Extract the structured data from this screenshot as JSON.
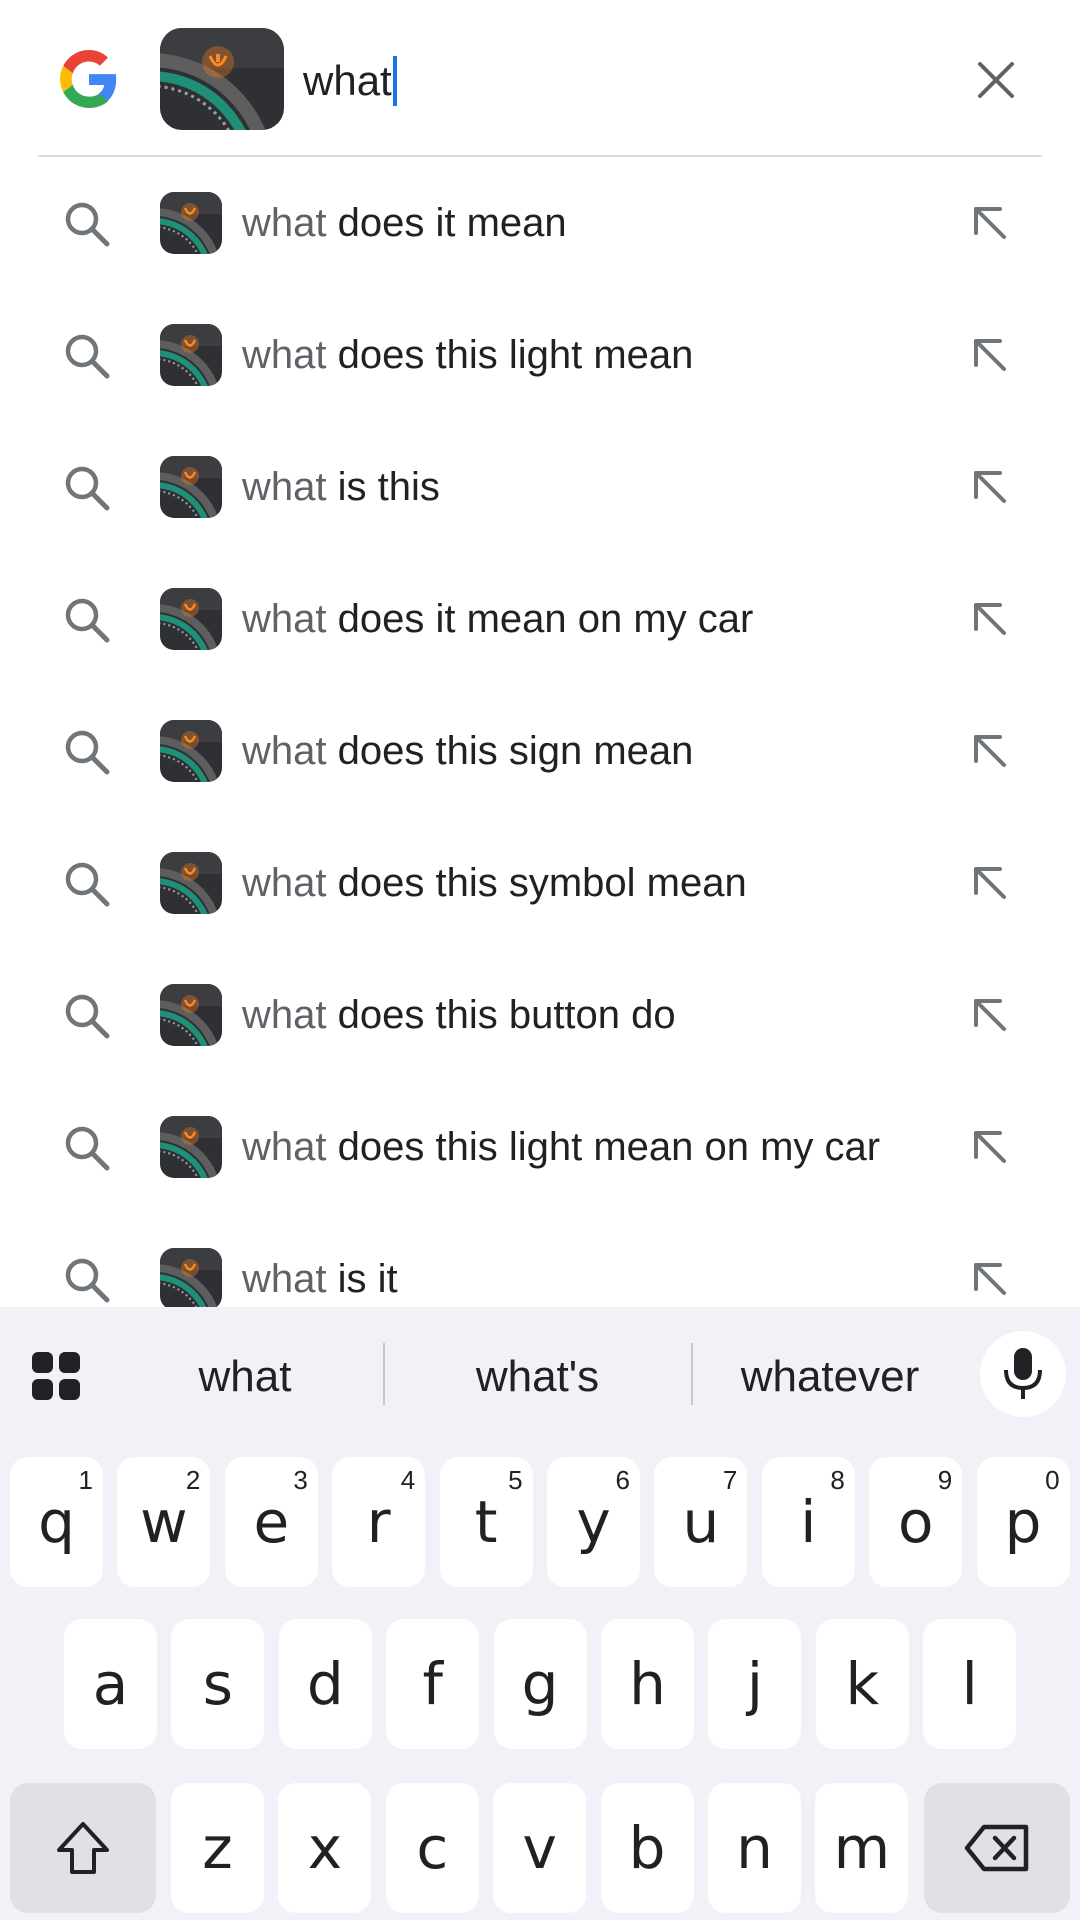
{
  "search": {
    "query": "what",
    "clear_icon": "close-icon",
    "logo_icon": "google-g-logo"
  },
  "suggestions": [
    {
      "prefix": "what",
      "rest": " does it mean"
    },
    {
      "prefix": "what",
      "rest": " does this light mean"
    },
    {
      "prefix": "what",
      "rest": " is this"
    },
    {
      "prefix": "what",
      "rest": " does it mean on my car"
    },
    {
      "prefix": "what",
      "rest": " does this sign mean"
    },
    {
      "prefix": "what",
      "rest": " does this symbol mean"
    },
    {
      "prefix": "what",
      "rest": " does this button do"
    },
    {
      "prefix": "what",
      "rest": " does this light mean on my car"
    },
    {
      "prefix": "what",
      "rest": " is it"
    }
  ],
  "keyboard": {
    "word_suggestions": [
      "what",
      "what's",
      "whatever"
    ],
    "row1": [
      {
        "key": "q",
        "hint": "1"
      },
      {
        "key": "w",
        "hint": "2"
      },
      {
        "key": "e",
        "hint": "3"
      },
      {
        "key": "r",
        "hint": "4"
      },
      {
        "key": "t",
        "hint": "5"
      },
      {
        "key": "y",
        "hint": "6"
      },
      {
        "key": "u",
        "hint": "7"
      },
      {
        "key": "i",
        "hint": "8"
      },
      {
        "key": "o",
        "hint": "9"
      },
      {
        "key": "p",
        "hint": "0"
      }
    ],
    "row2": [
      "a",
      "s",
      "d",
      "f",
      "g",
      "h",
      "j",
      "k",
      "l"
    ],
    "row3": [
      "z",
      "x",
      "c",
      "v",
      "b",
      "n",
      "m"
    ],
    "shift_icon": "shift-arrow-icon",
    "backspace_icon": "backspace-icon",
    "mic_icon": "microphone-icon",
    "apps_icon": "grid-apps-icon"
  },
  "colors": {
    "caret": "#1a73e8",
    "keyboard_bg": "#f0f2f7",
    "special_key": "#dfe1e6"
  }
}
